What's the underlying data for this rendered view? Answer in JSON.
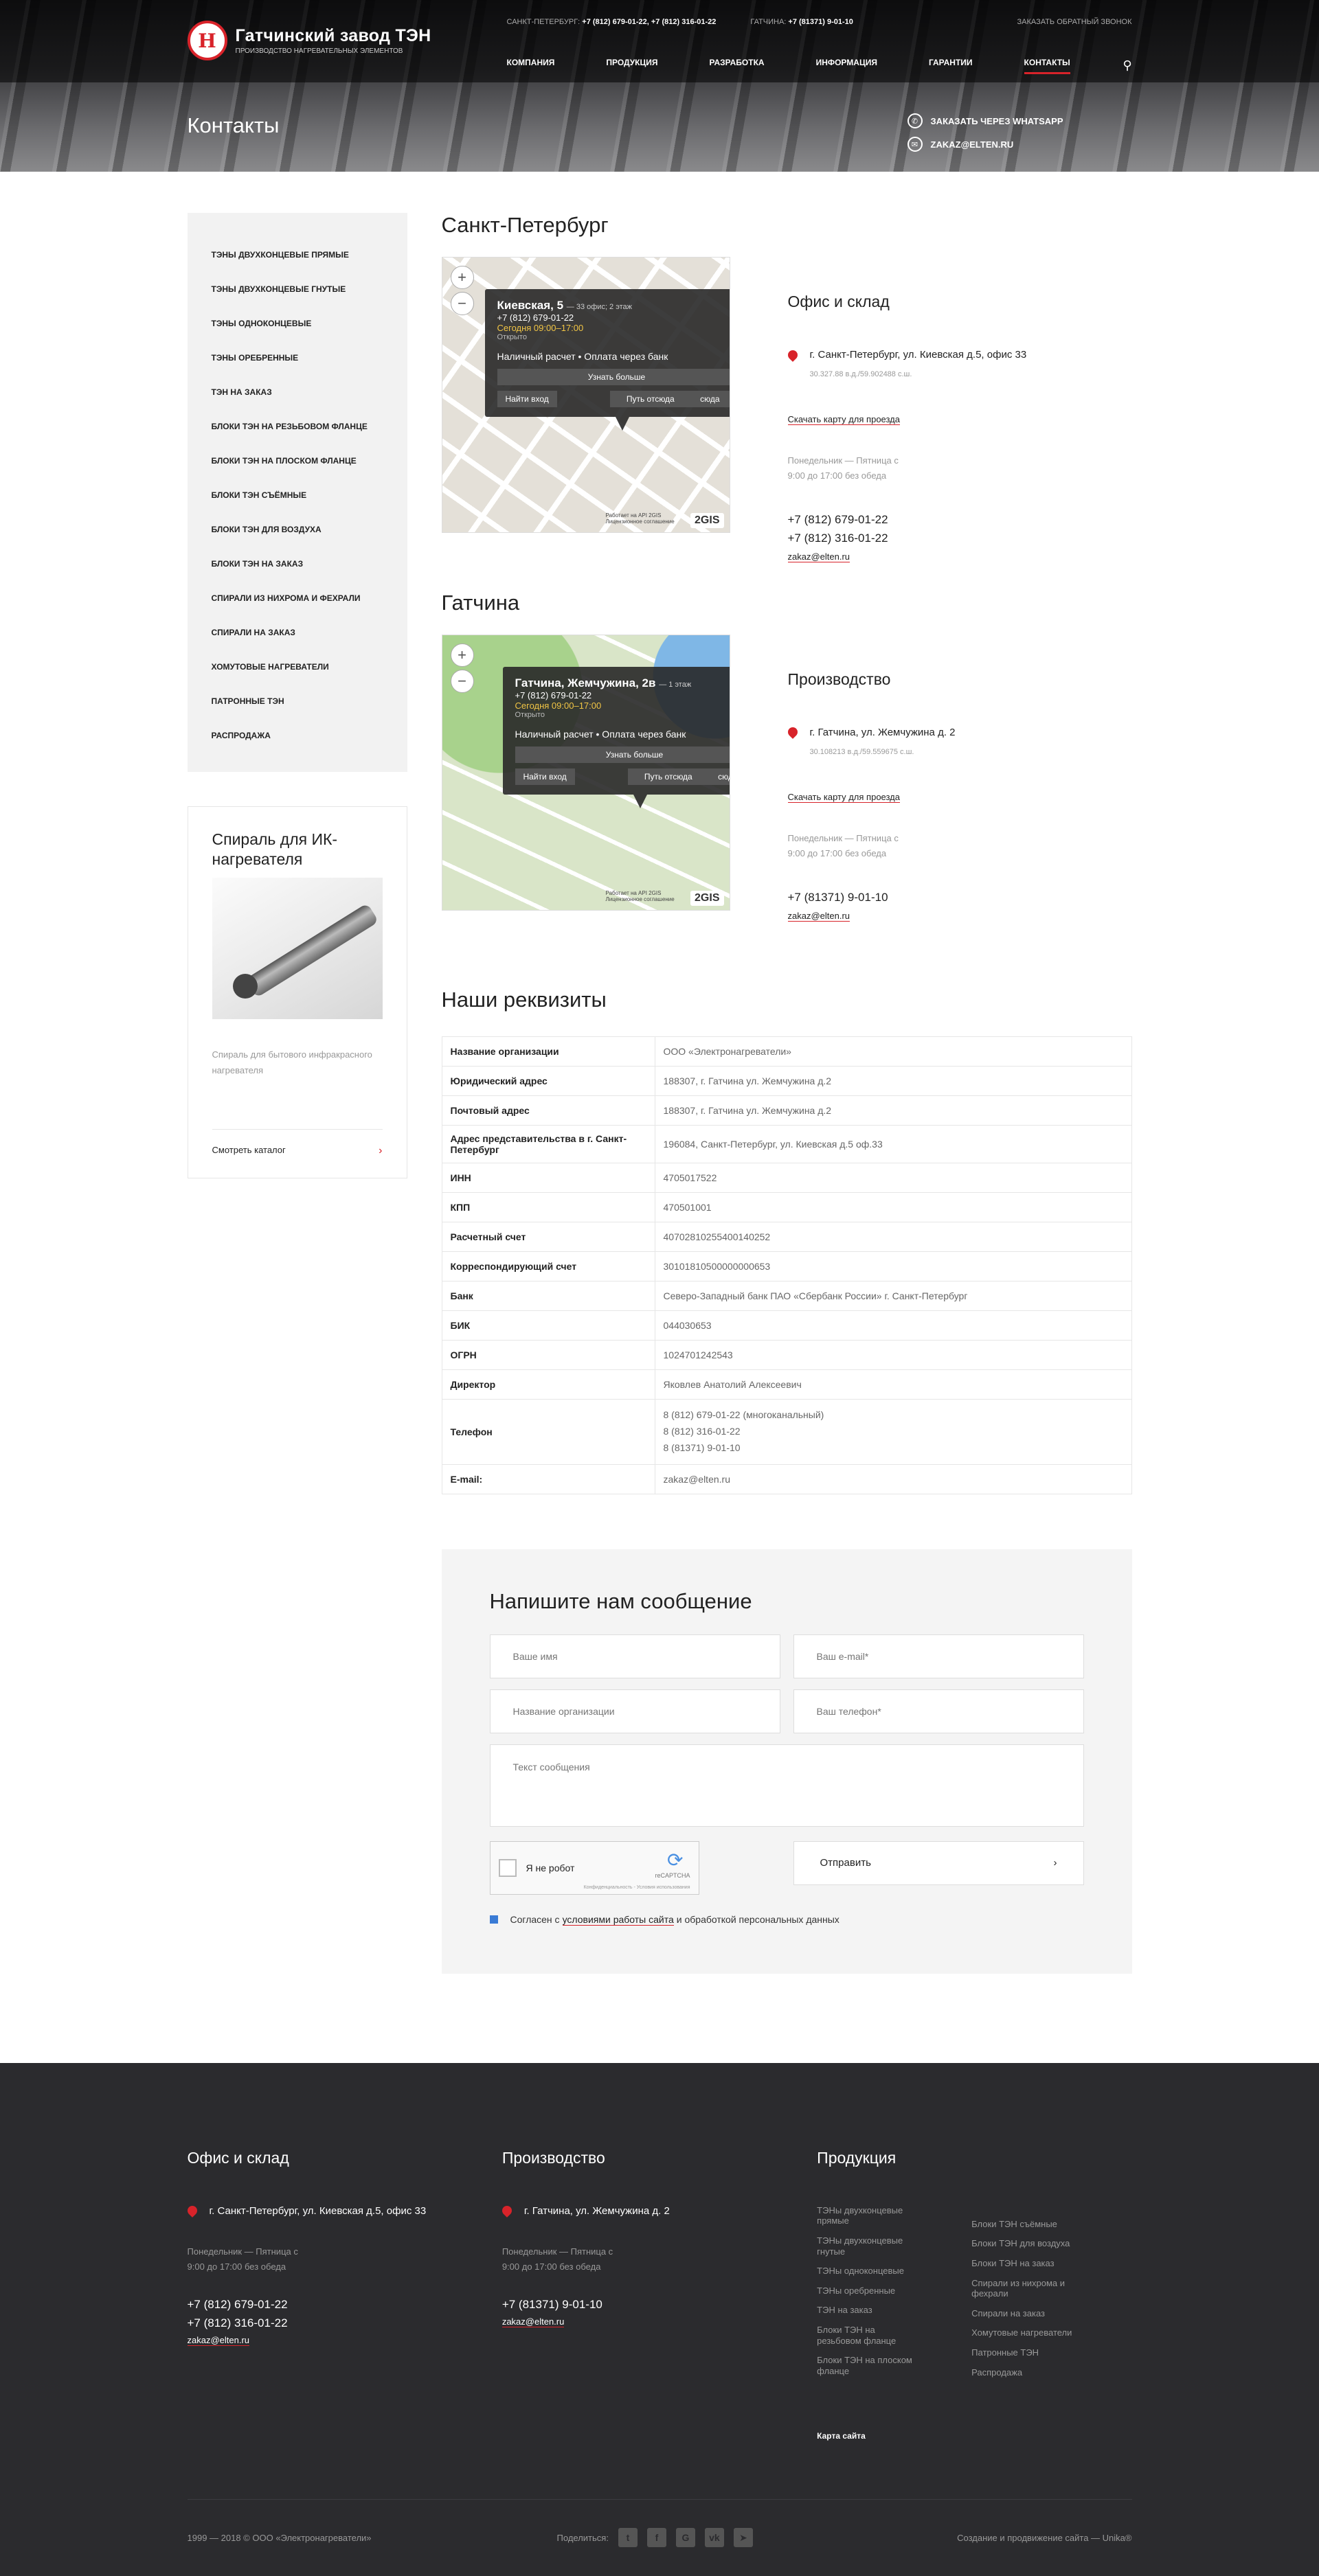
{
  "header": {
    "logo_mark": "Н",
    "logo_title": "Гатчинский завод ТЭН",
    "logo_sub": "производство нагревательных элементов",
    "spb_label": "Санкт-Петербург:",
    "spb_phones": "+7 (812) 679-01-22, +7 (812) 316-01-22",
    "gat_label": "Гатчина:",
    "gat_phone": "+7 (81371) 9-01-10",
    "callback": "Заказать обратный звонок",
    "nav": [
      "Компания",
      "Продукция",
      "Разработка",
      "Информация",
      "Гарантии",
      "Контакты"
    ],
    "page_title": "Контакты",
    "whatsapp": "Заказать через WhatsApp",
    "email": "zakaz@elten.ru"
  },
  "sidebar": {
    "menu": [
      "ТЭНы двухконцевые прямые",
      "ТЭНы двухконцевые гнутые",
      "ТЭНы одноконцевые",
      "ТЭНы оребренные",
      "ТЭН на заказ",
      "Блоки ТЭН на резьбовом фланце",
      "Блоки ТЭН на плоском фланце",
      "Блоки ТЭН съёмные",
      "Блоки ТЭН для воздуха",
      "Блоки ТЭН на заказ",
      "Спирали из нихрома и фехрали",
      "Спирали на заказ",
      "Хомутовые нагреватели",
      "Патронные ТЭН",
      "Распродажа"
    ],
    "promo_title": "Спираль для ИК-нагревателя",
    "promo_desc": "Спираль для бытового инфракрасного нагревателя",
    "promo_link": "Смотреть каталог"
  },
  "cities": [
    {
      "title": "Санкт-Петербург",
      "pop_addr": "Киевская, 5",
      "pop_floor": "— 33 офис; 2 этаж",
      "pop_phone": "+7 (812) 679-01-22",
      "pop_today": "Сегодня 09:00–17:00",
      "pop_open": "Открыто",
      "pop_pay": "Наличный расчет • Оплата через банк",
      "pop_more": "Узнать больше",
      "pop_entry": "Найти вход",
      "pop_route": "Путь отсюда",
      "pop_here": "сюда",
      "map_copy": "Работает на API 2GIS Лицензионное соглашение",
      "info_title": "Офис и склад",
      "info_addr": "г. Санкт-Петербург, ул. Киевская д.5, офис 33",
      "info_coords": "30.327.88 в.д./59.902488 с.ш.",
      "info_link": "Скачать карту для проезда",
      "info_hours": "Понедельник — Пятница с 9:00 до 17:00 без обеда",
      "phone1": "+7 (812) 679-01-22",
      "phone2": "+7 (812) 316-01-22",
      "email": "zakaz@elten.ru"
    },
    {
      "title": "Гатчина",
      "pop_addr": "Гатчина, Жемчужина, 2в",
      "pop_floor": "— 1 этаж",
      "pop_phone": "+7 (812) 679-01-22",
      "pop_today": "Сегодня 09:00–17:00",
      "pop_open": "Открыто",
      "pop_pay": "Наличный расчет • Оплата через банк",
      "pop_more": "Узнать больше",
      "pop_entry": "Найти вход",
      "pop_route": "Путь отсюда",
      "pop_here": "сюда",
      "map_copy": "Работает на API 2GIS Лицензионное соглашение",
      "info_title": "Производство",
      "info_addr": "г. Гатчина, ул. Жемчужина д. 2",
      "info_coords": "30.108213 в.д./59.559675 с.ш.",
      "info_link": "Скачать карту для проезда",
      "info_hours": "Понедельник — Пятница с 9:00 до 17:00 без обеда",
      "phone1": "+7 (81371) 9-01-10",
      "phone2": "",
      "email": "zakaz@elten.ru"
    }
  ],
  "requisites": {
    "title": "Наши реквизиты",
    "rows": [
      [
        "Название организации",
        "ООО «Электронагреватели»"
      ],
      [
        "Юридический адрес",
        "188307, г. Гатчина ул. Жемчужина д.2"
      ],
      [
        "Почтовый адрес",
        "188307, г. Гатчина ул. Жемчужина д.2"
      ],
      [
        "Адрес представительства в г. Санкт-Петербург",
        "196084, Санкт-Петербург, ул. Киевская д.5 оф.33"
      ],
      [
        "ИНН",
        "4705017522"
      ],
      [
        "КПП",
        "470501001"
      ],
      [
        "Расчетный счет",
        "40702810255400140252"
      ],
      [
        "Корреспондирующий счет",
        "30101810500000000653"
      ],
      [
        "Банк",
        "Северо-Западный банк ПАО «Сбербанк России» г. Санкт-Петербург"
      ],
      [
        "БИК",
        "044030653"
      ],
      [
        "ОГРН",
        "1024701242543"
      ],
      [
        "Директор",
        "Яковлев Анатолий Алексеевич"
      ],
      [
        "Телефон",
        "8 (812) 679-01-22 (многоканальный)\n8 (812) 316-01-22\n8 (81371) 9-01-10"
      ],
      [
        "E-mail:",
        "zakaz@elten.ru"
      ]
    ]
  },
  "form": {
    "title": "Напишите нам сообщение",
    "name_ph": "Ваше имя",
    "email_ph": "Ваш e-mail*",
    "org_ph": "Название организации",
    "phone_ph": "Ваш телефон*",
    "msg_ph": "Текст сообщения",
    "captcha_label": "Я не робот",
    "captcha_brand": "reCAPTCHA",
    "captcha_links": "Конфиденциальность - Условия использования",
    "submit": "Отправить",
    "agree_pre": "Согласен с",
    "agree_terms": "условиями работы сайта",
    "agree_post": "и обработкой персональных данных"
  },
  "footer": {
    "office_title": "Офис и склад",
    "office_addr": "г. Санкт-Петербург, ул. Киевская д.5, офис 33",
    "office_hours": "Понедельник — Пятница с 9:00 до 17:00 без обеда",
    "office_phone1": "+7 (812) 679-01-22",
    "office_phone2": "+7 (812) 316-01-22",
    "office_email": "zakaz@elten.ru",
    "prod_title": "Производство",
    "prod_addr": "г. Гатчина, ул. Жемчужина д. 2",
    "prod_hours": "Понедельник — Пятница с 9:00 до 17:00 без обеда",
    "prod_phone": "+7 (81371) 9-01-10",
    "prod_email": "zakaz@elten.ru",
    "products_title": "Продукция",
    "products_a": [
      "ТЭНы двухконцевые прямые",
      "ТЭНы двухконцевые гнутые",
      "ТЭНы одноконцевые",
      "ТЭНы оребренные",
      "ТЭН на заказ",
      "Блоки ТЭН на резьбовом фланце",
      "Блоки ТЭН на плоском фланце"
    ],
    "products_b": [
      "Блоки ТЭН съёмные",
      "Блоки ТЭН для воздуха",
      "Блоки ТЭН на заказ",
      "Спирали из нихрома и фехрали",
      "Спирали на заказ",
      "Хомутовые нагреватели",
      "Патронные ТЭН",
      "Распродажа"
    ],
    "catalog": "Карта сайта",
    "copyright": "1999 — 2018 ©  ООО «Электронагреватели»",
    "share": "Поделиться:",
    "dev": "Создание и продвижение сайта — Unika®"
  }
}
